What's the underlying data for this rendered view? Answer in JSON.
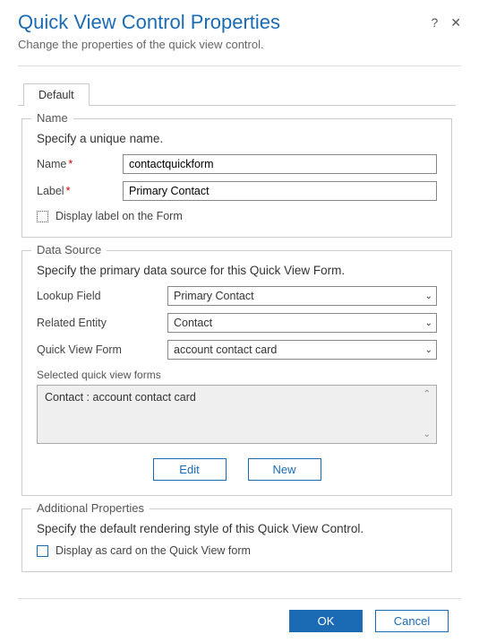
{
  "header": {
    "title": "Quick View Control Properties",
    "subtitle": "Change the properties of the quick view control."
  },
  "tabs": {
    "default": "Default"
  },
  "nameSection": {
    "legend": "Name",
    "hint": "Specify a unique name.",
    "nameLabel": "Name",
    "nameValue": "contactquickform",
    "labelLabel": "Label",
    "labelValue": "Primary Contact",
    "displayLabelCheckbox": "Display label on the Form"
  },
  "dataSource": {
    "legend": "Data Source",
    "hint": "Specify the primary data source for this Quick View Form.",
    "lookupLabel": "Lookup Field",
    "lookupValue": "Primary Contact",
    "relatedLabel": "Related Entity",
    "relatedValue": "Contact",
    "qvfLabel": "Quick View Form",
    "qvfValue": "account contact card",
    "selectedLabel": "Selected quick view forms",
    "selectedItem": "Contact : account contact card",
    "editBtn": "Edit",
    "newBtn": "New"
  },
  "additional": {
    "legend": "Additional Properties",
    "hint": "Specify the default rendering style of this Quick View Control.",
    "cardCheckbox": "Display as card on the Quick View form"
  },
  "footer": {
    "ok": "OK",
    "cancel": "Cancel"
  }
}
